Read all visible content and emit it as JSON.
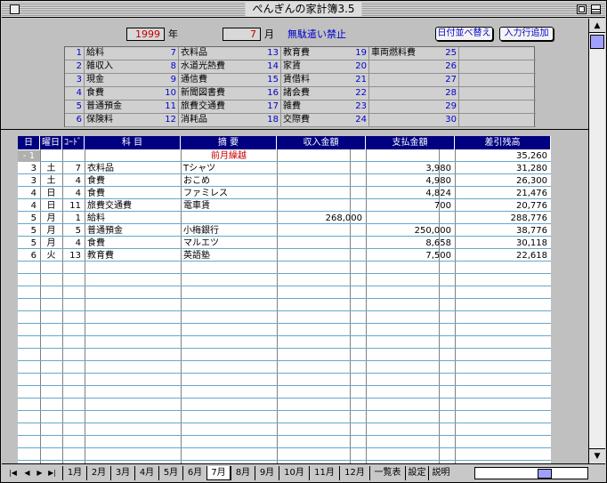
{
  "window": {
    "title": "ぺんぎんの家計簿3.5"
  },
  "header": {
    "year": "1999",
    "year_unit": "年",
    "month": "7",
    "month_unit": "月",
    "motto": "無駄遣い禁止",
    "sort_button": "日付並べ替え",
    "add_row_button": "入力行追加"
  },
  "codes": [
    {
      "num": "1",
      "name": "給料"
    },
    {
      "num": "2",
      "name": "雑収入"
    },
    {
      "num": "3",
      "name": "現金"
    },
    {
      "num": "4",
      "name": "食費"
    },
    {
      "num": "5",
      "name": "普通預金"
    },
    {
      "num": "6",
      "name": "保険料"
    },
    {
      "num": "7",
      "name": "衣料品"
    },
    {
      "num": "8",
      "name": "水道光熱費"
    },
    {
      "num": "9",
      "name": "通信費"
    },
    {
      "num": "10",
      "name": "新聞図書費"
    },
    {
      "num": "11",
      "name": "旅費交通費"
    },
    {
      "num": "12",
      "name": "消耗品"
    },
    {
      "num": "13",
      "name": "教育費"
    },
    {
      "num": "14",
      "name": "家賃"
    },
    {
      "num": "15",
      "name": "賃借料"
    },
    {
      "num": "16",
      "name": "諸会費"
    },
    {
      "num": "17",
      "name": "雑費"
    },
    {
      "num": "18",
      "name": "交際費"
    },
    {
      "num": "19",
      "name": "車両燃料費"
    },
    {
      "num": "20",
      "name": ""
    },
    {
      "num": "21",
      "name": ""
    },
    {
      "num": "22",
      "name": ""
    },
    {
      "num": "23",
      "name": ""
    },
    {
      "num": "24",
      "name": ""
    },
    {
      "num": "25",
      "name": ""
    },
    {
      "num": "26",
      "name": ""
    },
    {
      "num": "27",
      "name": ""
    },
    {
      "num": "28",
      "name": ""
    },
    {
      "num": "29",
      "name": ""
    },
    {
      "num": "30",
      "name": ""
    }
  ],
  "ledger": {
    "headers": {
      "day": "日",
      "weekday": "曜日",
      "code": "ｺｰﾄﾞ",
      "account": "科 目",
      "memo": "摘 要",
      "income": "収入金額",
      "expense": "支払金額",
      "balance": "差引残高"
    },
    "carry_over": {
      "day": "- 1",
      "label": "前月繰越",
      "balance": "35,260"
    },
    "rows": [
      {
        "day": "3",
        "weekday": "土",
        "code": "7",
        "account": "衣料品",
        "memo": "Tシャツ",
        "income": "",
        "expense": "3,980",
        "balance": "31,280"
      },
      {
        "day": "3",
        "weekday": "土",
        "code": "4",
        "account": "食費",
        "memo": "おこめ",
        "income": "",
        "expense": "4,980",
        "balance": "26,300"
      },
      {
        "day": "4",
        "weekday": "日",
        "code": "4",
        "account": "食費",
        "memo": "ファミレス",
        "income": "",
        "expense": "4,824",
        "balance": "21,476"
      },
      {
        "day": "4",
        "weekday": "日",
        "code": "11",
        "account": "旅費交通費",
        "memo": "電車賃",
        "income": "",
        "expense": "700",
        "balance": "20,776"
      },
      {
        "day": "5",
        "weekday": "月",
        "code": "1",
        "account": "給料",
        "memo": "",
        "income": "268,000",
        "expense": "",
        "balance": "288,776"
      },
      {
        "day": "5",
        "weekday": "月",
        "code": "5",
        "account": "普通預金",
        "memo": "小梅銀行",
        "income": "",
        "expense": "250,000",
        "balance": "38,776"
      },
      {
        "day": "5",
        "weekday": "月",
        "code": "4",
        "account": "食費",
        "memo": "マルエツ",
        "income": "",
        "expense": "8,658",
        "balance": "30,118"
      },
      {
        "day": "6",
        "weekday": "火",
        "code": "13",
        "account": "教育費",
        "memo": "英語塾",
        "income": "",
        "expense": "7,500",
        "balance": "22,618"
      }
    ]
  },
  "tabs": [
    "1月",
    "2月",
    "3月",
    "4月",
    "5月",
    "6月",
    "7月",
    "8月",
    "9月",
    "10月",
    "11月",
    "12月",
    "一覧表",
    "設定",
    "説明"
  ],
  "active_tab": "7月",
  "nav_icons": [
    "first-sheet-icon",
    "prev-sheet-icon",
    "next-sheet-icon",
    "last-sheet-icon"
  ],
  "colors": {
    "header_bg": "#000080",
    "accent_red": "#cc0000",
    "accent_blue": "#0000cc",
    "row_line": "#66a8cc"
  }
}
